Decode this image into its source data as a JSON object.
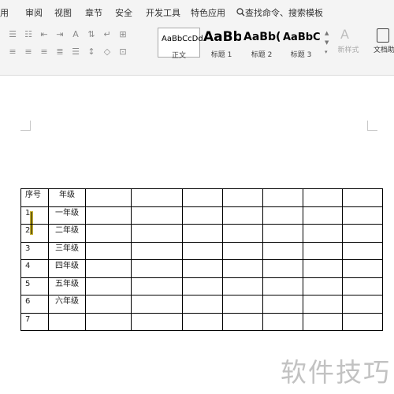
{
  "menu": {
    "items": [
      {
        "label": "用"
      },
      {
        "label": "审阅"
      },
      {
        "label": "视图"
      },
      {
        "label": "章节"
      },
      {
        "label": "安全"
      },
      {
        "label": "开发工具"
      },
      {
        "label": "特色应用"
      }
    ],
    "search_label": "查找命令、搜索模板"
  },
  "ribbon": {
    "styles": [
      {
        "preview": "AaBbCcDd",
        "label": "正文"
      },
      {
        "preview": "AaBb",
        "label": "标题 1"
      },
      {
        "preview": "AaBb(",
        "label": "标题 2"
      },
      {
        "preview": "AaBbC",
        "label": "标题 3"
      }
    ],
    "new_style_label": "新样式",
    "doc_helper_label": "文档助"
  },
  "table": {
    "headers": [
      "序号",
      "年级"
    ],
    "rows": [
      [
        "1",
        "一年级"
      ],
      [
        "2",
        "二年级"
      ],
      [
        "3",
        "三年级"
      ],
      [
        "4",
        "四年级"
      ],
      [
        "5",
        "五年级"
      ],
      [
        "6",
        "六年级"
      ],
      [
        "7",
        ""
      ]
    ]
  },
  "watermark": "软件技巧",
  "colors": {
    "cursor": "#b8a428",
    "accent": "#1e6fd9"
  }
}
